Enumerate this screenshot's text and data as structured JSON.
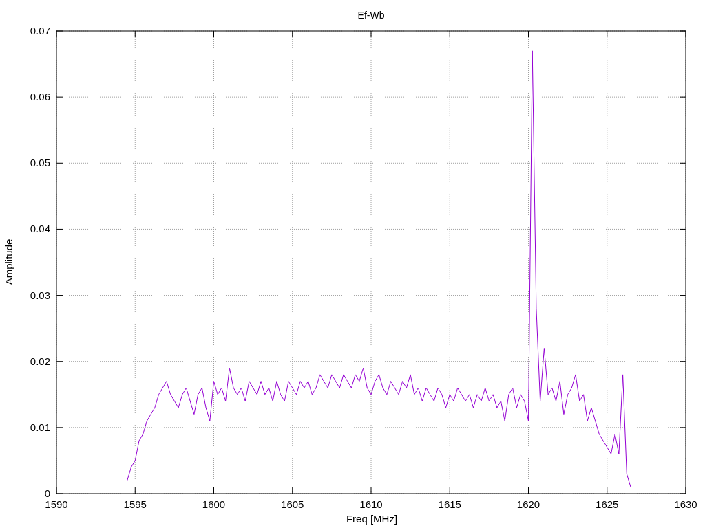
{
  "chart_data": {
    "type": "line",
    "title": "Ef-Wb",
    "xlabel": "Freq [MHz]",
    "ylabel": "Amplitude",
    "xlim": [
      1590,
      1630
    ],
    "ylim": [
      0,
      0.07
    ],
    "grid": true,
    "xticks": [
      1590,
      1595,
      1600,
      1605,
      1610,
      1615,
      1620,
      1625,
      1630
    ],
    "yticks": [
      0,
      0.01,
      0.02,
      0.03,
      0.04,
      0.05,
      0.06,
      0.07
    ],
    "x": [
      1594.5,
      1594.75,
      1595,
      1595.25,
      1595.5,
      1595.75,
      1596,
      1596.25,
      1596.5,
      1596.75,
      1597,
      1597.25,
      1597.5,
      1597.75,
      1598,
      1598.25,
      1598.5,
      1598.75,
      1599,
      1599.25,
      1599.5,
      1599.75,
      1600,
      1600.25,
      1600.5,
      1600.75,
      1601,
      1601.25,
      1601.5,
      1601.75,
      1602,
      1602.25,
      1602.5,
      1602.75,
      1603,
      1603.25,
      1603.5,
      1603.75,
      1604,
      1604.25,
      1604.5,
      1604.75,
      1605,
      1605.25,
      1605.5,
      1605.75,
      1606,
      1606.25,
      1606.5,
      1606.75,
      1607,
      1607.25,
      1607.5,
      1607.75,
      1608,
      1608.25,
      1608.5,
      1608.75,
      1609,
      1609.25,
      1609.5,
      1609.75,
      1610,
      1610.25,
      1610.5,
      1610.75,
      1611,
      1611.25,
      1611.5,
      1611.75,
      1612,
      1612.25,
      1612.5,
      1612.75,
      1613,
      1613.25,
      1613.5,
      1613.75,
      1614,
      1614.25,
      1614.5,
      1614.75,
      1615,
      1615.25,
      1615.5,
      1615.75,
      1616,
      1616.25,
      1616.5,
      1616.75,
      1617,
      1617.25,
      1617.5,
      1617.75,
      1618,
      1618.25,
      1618.5,
      1618.75,
      1619,
      1619.25,
      1619.5,
      1619.75,
      1620,
      1620.25,
      1620.5,
      1620.75,
      1621,
      1621.25,
      1621.5,
      1621.75,
      1622,
      1622.25,
      1622.5,
      1622.75,
      1623,
      1623.25,
      1623.5,
      1623.75,
      1624,
      1624.25,
      1624.5,
      1624.75,
      1625,
      1625.25,
      1625.5,
      1625.75,
      1626,
      1626.25,
      1626.5
    ],
    "series": [
      {
        "color": "#9400d3",
        "values": [
          0.002,
          0.004,
          0.005,
          0.008,
          0.009,
          0.011,
          0.012,
          0.013,
          0.015,
          0.016,
          0.017,
          0.015,
          0.014,
          0.013,
          0.015,
          0.016,
          0.014,
          0.012,
          0.015,
          0.016,
          0.013,
          0.011,
          0.017,
          0.015,
          0.016,
          0.014,
          0.019,
          0.016,
          0.015,
          0.016,
          0.014,
          0.017,
          0.016,
          0.015,
          0.017,
          0.015,
          0.016,
          0.014,
          0.017,
          0.015,
          0.014,
          0.017,
          0.016,
          0.015,
          0.017,
          0.016,
          0.017,
          0.015,
          0.016,
          0.018,
          0.017,
          0.016,
          0.018,
          0.017,
          0.016,
          0.018,
          0.017,
          0.016,
          0.018,
          0.017,
          0.019,
          0.016,
          0.015,
          0.017,
          0.018,
          0.016,
          0.015,
          0.017,
          0.016,
          0.015,
          0.017,
          0.016,
          0.018,
          0.015,
          0.016,
          0.014,
          0.016,
          0.015,
          0.014,
          0.016,
          0.015,
          0.013,
          0.015,
          0.014,
          0.016,
          0.015,
          0.014,
          0.015,
          0.013,
          0.015,
          0.014,
          0.016,
          0.014,
          0.015,
          0.013,
          0.014,
          0.011,
          0.015,
          0.016,
          0.013,
          0.015,
          0.014,
          0.011,
          0.067,
          0.028,
          0.014,
          0.022,
          0.015,
          0.016,
          0.014,
          0.017,
          0.012,
          0.015,
          0.016,
          0.018,
          0.014,
          0.015,
          0.011,
          0.013,
          0.011,
          0.009,
          0.008,
          0.007,
          0.006,
          0.009,
          0.006,
          0.018,
          0.003,
          0.001
        ]
      }
    ]
  }
}
